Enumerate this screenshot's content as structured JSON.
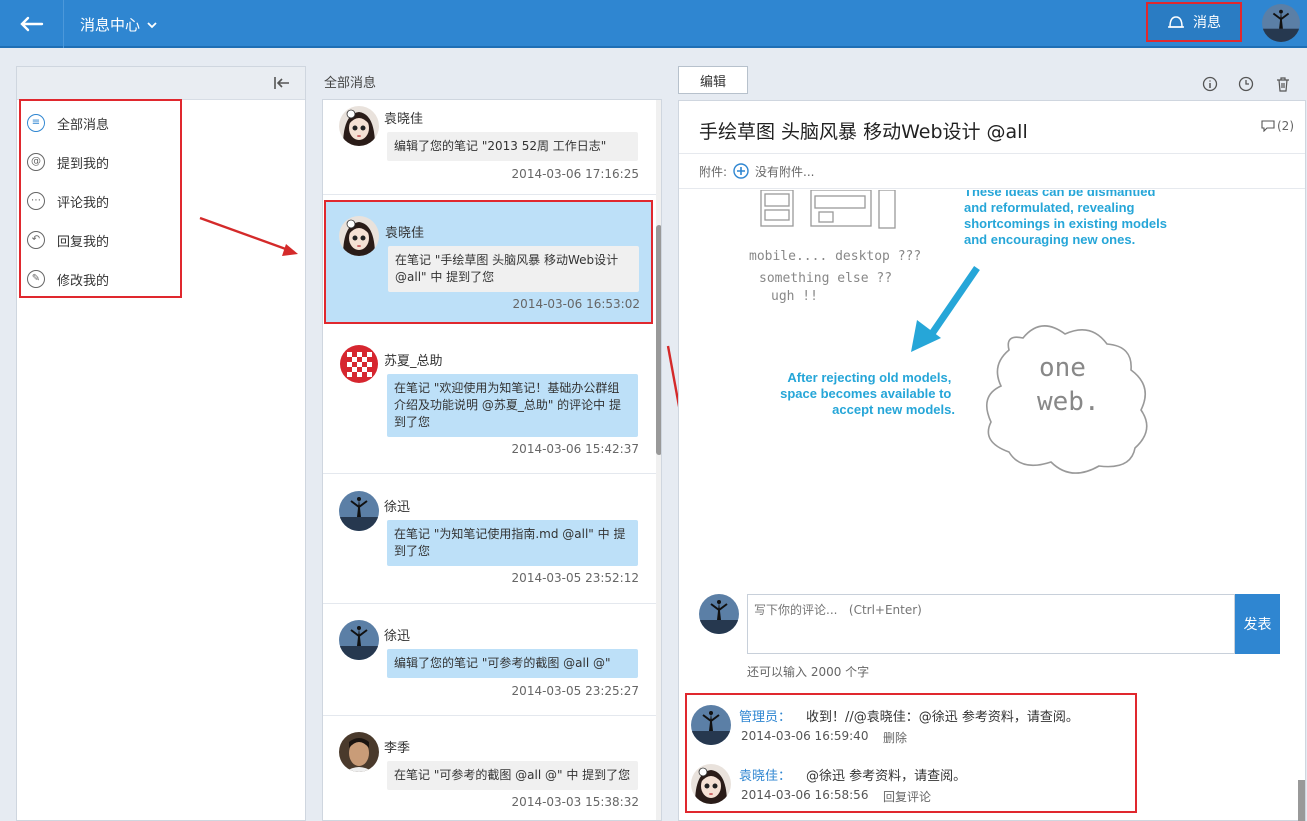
{
  "header": {
    "title": "消息中心",
    "message_button_label": "消息"
  },
  "sidebar": {
    "items": [
      {
        "label": "全部消息",
        "icon": "list-icon"
      },
      {
        "label": "提到我的",
        "icon": "at-icon"
      },
      {
        "label": "评论我的",
        "icon": "comment-icon"
      },
      {
        "label": "回复我的",
        "icon": "reply-icon"
      },
      {
        "label": "修改我的",
        "icon": "edit-icon"
      }
    ]
  },
  "middle": {
    "title": "全部消息",
    "items": [
      {
        "name": "袁晓佳",
        "text": "编辑了您的笔记 \"2013 52周 工作日志\"",
        "time": "2014-03-06 17:16:25"
      },
      {
        "name": "袁晓佳",
        "text": "在笔记 \"手绘草图 头脑风暴 移动Web设计 @all\" 中 提到了您",
        "time": "2014-03-06 16:53:02"
      },
      {
        "name": "苏夏_总助",
        "text": "在笔记 \"欢迎使用为知笔记！基础办公群组介绍及功能说明 @苏夏_总助\" 的评论中 提到了您",
        "time": "2014-03-06 15:42:37"
      },
      {
        "name": "徐迅",
        "text": "在笔记 \"为知笔记使用指南.md @all\" 中 提到了您",
        "time": "2014-03-05 23:52:12"
      },
      {
        "name": "徐迅",
        "text": "编辑了您的笔记 \"可参考的截图 @all @\"",
        "time": "2014-03-05 23:25:27"
      },
      {
        "name": "李季",
        "text": "在笔记 \"可参考的截图 @all @\" 中 提到了您",
        "time": "2014-03-03 15:38:32"
      }
    ]
  },
  "note": {
    "edit_label": "编辑",
    "title": "手绘草图 头脑风暴 移动Web设计 @all",
    "comment_count": "(2)",
    "attach_label": "附件:",
    "attach_none": "没有附件...",
    "sketch": {
      "device_text_1": "mobile.... desktop ???",
      "device_text_2": "something else ??",
      "device_text_3": "ugh !!",
      "top_lines": [
        "These ideas can be dismantled",
        "and reformulated, revealing",
        "shortcomings in existing models",
        "and encouraging new ones."
      ],
      "bottom_lines": [
        "After rejecting old models,",
        "space becomes available to",
        "accept new models."
      ],
      "cloud_1": "one",
      "cloud_2": "web."
    },
    "comment_placeholder": "写下你的评论...   (Ctrl+Enter)",
    "send_label": "发表",
    "remaining": "还可以输入 2000 个字",
    "comments": [
      {
        "author": "管理员：",
        "text": "收到！//@袁晓佳：@徐迅 参考资料，请查阅。",
        "time": "2014-03-06 16:59:40",
        "action": "删除"
      },
      {
        "author": "袁晓佳：",
        "text": "@徐迅 参考资料，请查阅。",
        "time": "2014-03-06 16:58:56",
        "action": "回复评论"
      }
    ]
  },
  "colors": {
    "brand": "#2f86d1",
    "highlight": "#e0282e",
    "bubble": "#bde0f8",
    "sketch_blue": "#26a6d8"
  }
}
